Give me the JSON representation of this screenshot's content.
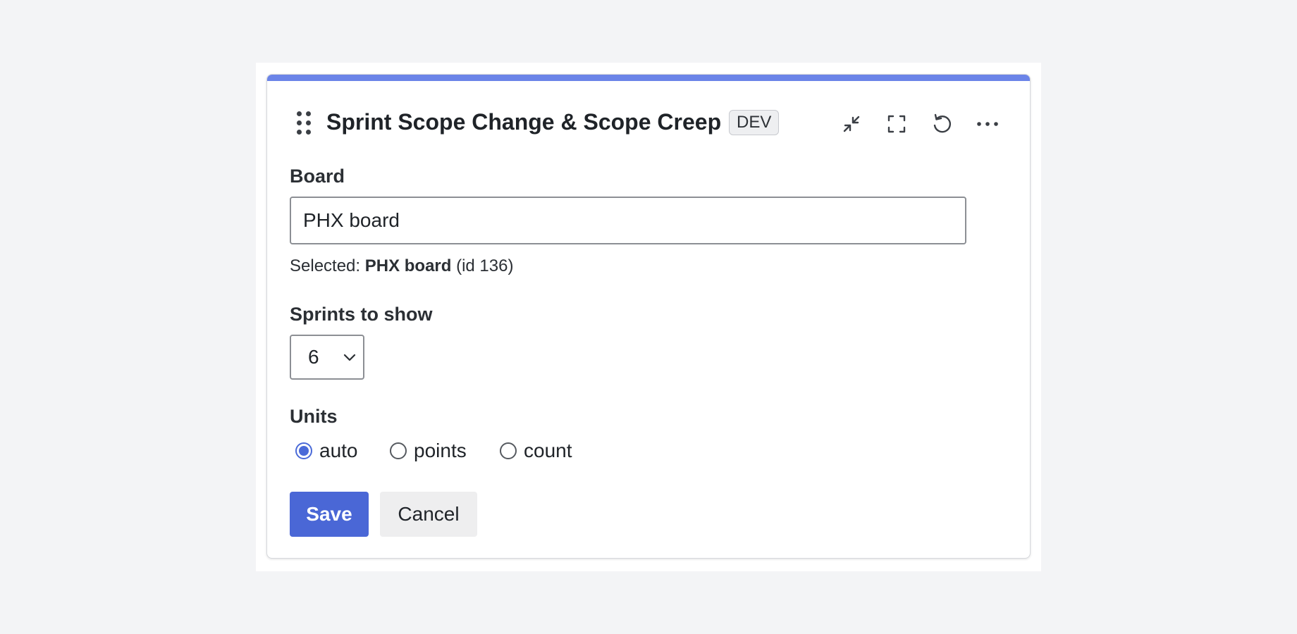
{
  "widget": {
    "title": "Sprint Scope Change & Scope Creep",
    "badge": "DEV",
    "accent_color": "#6b84e8",
    "toolbar": [
      {
        "name": "collapse",
        "icon": "collapse-arrows-icon"
      },
      {
        "name": "fullscreen",
        "icon": "fullscreen-icon"
      },
      {
        "name": "reset",
        "icon": "reset-icon"
      },
      {
        "name": "more",
        "icon": "more-dots-icon"
      }
    ]
  },
  "form": {
    "board": {
      "label": "Board",
      "value": "PHX board",
      "selected_prefix": "Selected: ",
      "selected_name": "PHX board",
      "selected_suffix": " (id 136)"
    },
    "sprints": {
      "label": "Sprints to show",
      "value": "6"
    },
    "units": {
      "label": "Units",
      "options": [
        {
          "label": "auto",
          "checked": true
        },
        {
          "label": "points",
          "checked": false
        },
        {
          "label": "count",
          "checked": false
        }
      ],
      "radio_color": "#4a6ad8"
    },
    "buttons": {
      "save": "Save",
      "cancel": "Cancel",
      "save_color": "#4a67d6"
    }
  }
}
